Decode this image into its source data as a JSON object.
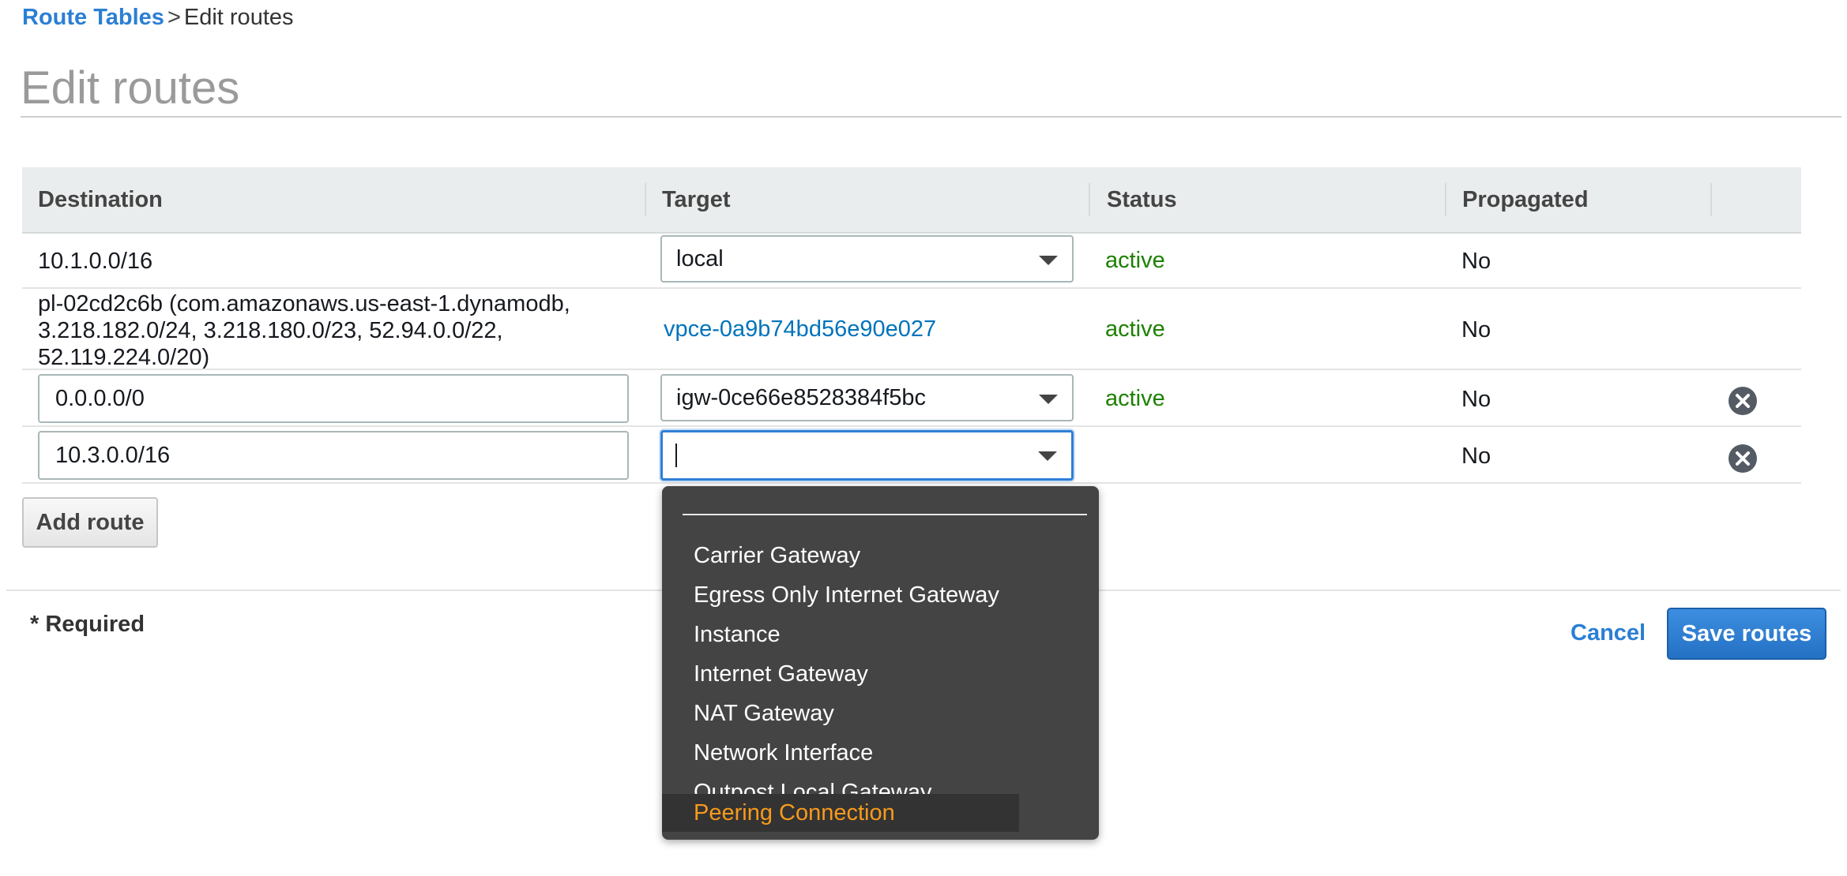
{
  "breadcrumb": {
    "parent": "Route Tables",
    "separator": ">",
    "current": "Edit routes"
  },
  "page_title": "Edit routes",
  "table": {
    "headers": [
      "Destination",
      "Target",
      "Status",
      "Propagated"
    ],
    "rows": [
      {
        "destination": "10.1.0.0/16",
        "target": "local",
        "status": "active",
        "propagated": "No"
      },
      {
        "destination_lines": [
          "pl-02cd2c6b (com.amazonaws.us-east-1.dynamodb,",
          "3.218.182.0/24, 3.218.180.0/23, 52.94.0.0/22,",
          "52.119.224.0/20)"
        ],
        "target": "vpce-0a9b74bd56e90e027",
        "status": "active",
        "propagated": "No"
      },
      {
        "destination": "0.0.0.0/0",
        "target": "igw-0ce66e8528384f5bc",
        "status": "active",
        "propagated": "No"
      },
      {
        "destination": "10.3.0.0/16",
        "target": "",
        "status": "",
        "propagated": "No"
      }
    ]
  },
  "add_route_label": "Add route",
  "required_note": "* Required",
  "cancel_label": "Cancel",
  "save_label": "Save routes",
  "target_menu": {
    "items": [
      "Carrier Gateway",
      "Egress Only Internet Gateway",
      "Instance",
      "Internet Gateway",
      "NAT Gateway",
      "Network Interface",
      "Outpost Local Gateway",
      "Peering Connection"
    ],
    "highlighted": "Peering Connection"
  },
  "colors": {
    "link": "#2b7fd4",
    "active_status": "#1d8102",
    "menu_background": "#444444",
    "menu_highlight_text": "#f89a1c",
    "primary_button": "#2471c4"
  },
  "icons": {
    "remove": "close-circle-icon",
    "dropdown": "caret-down-icon"
  }
}
